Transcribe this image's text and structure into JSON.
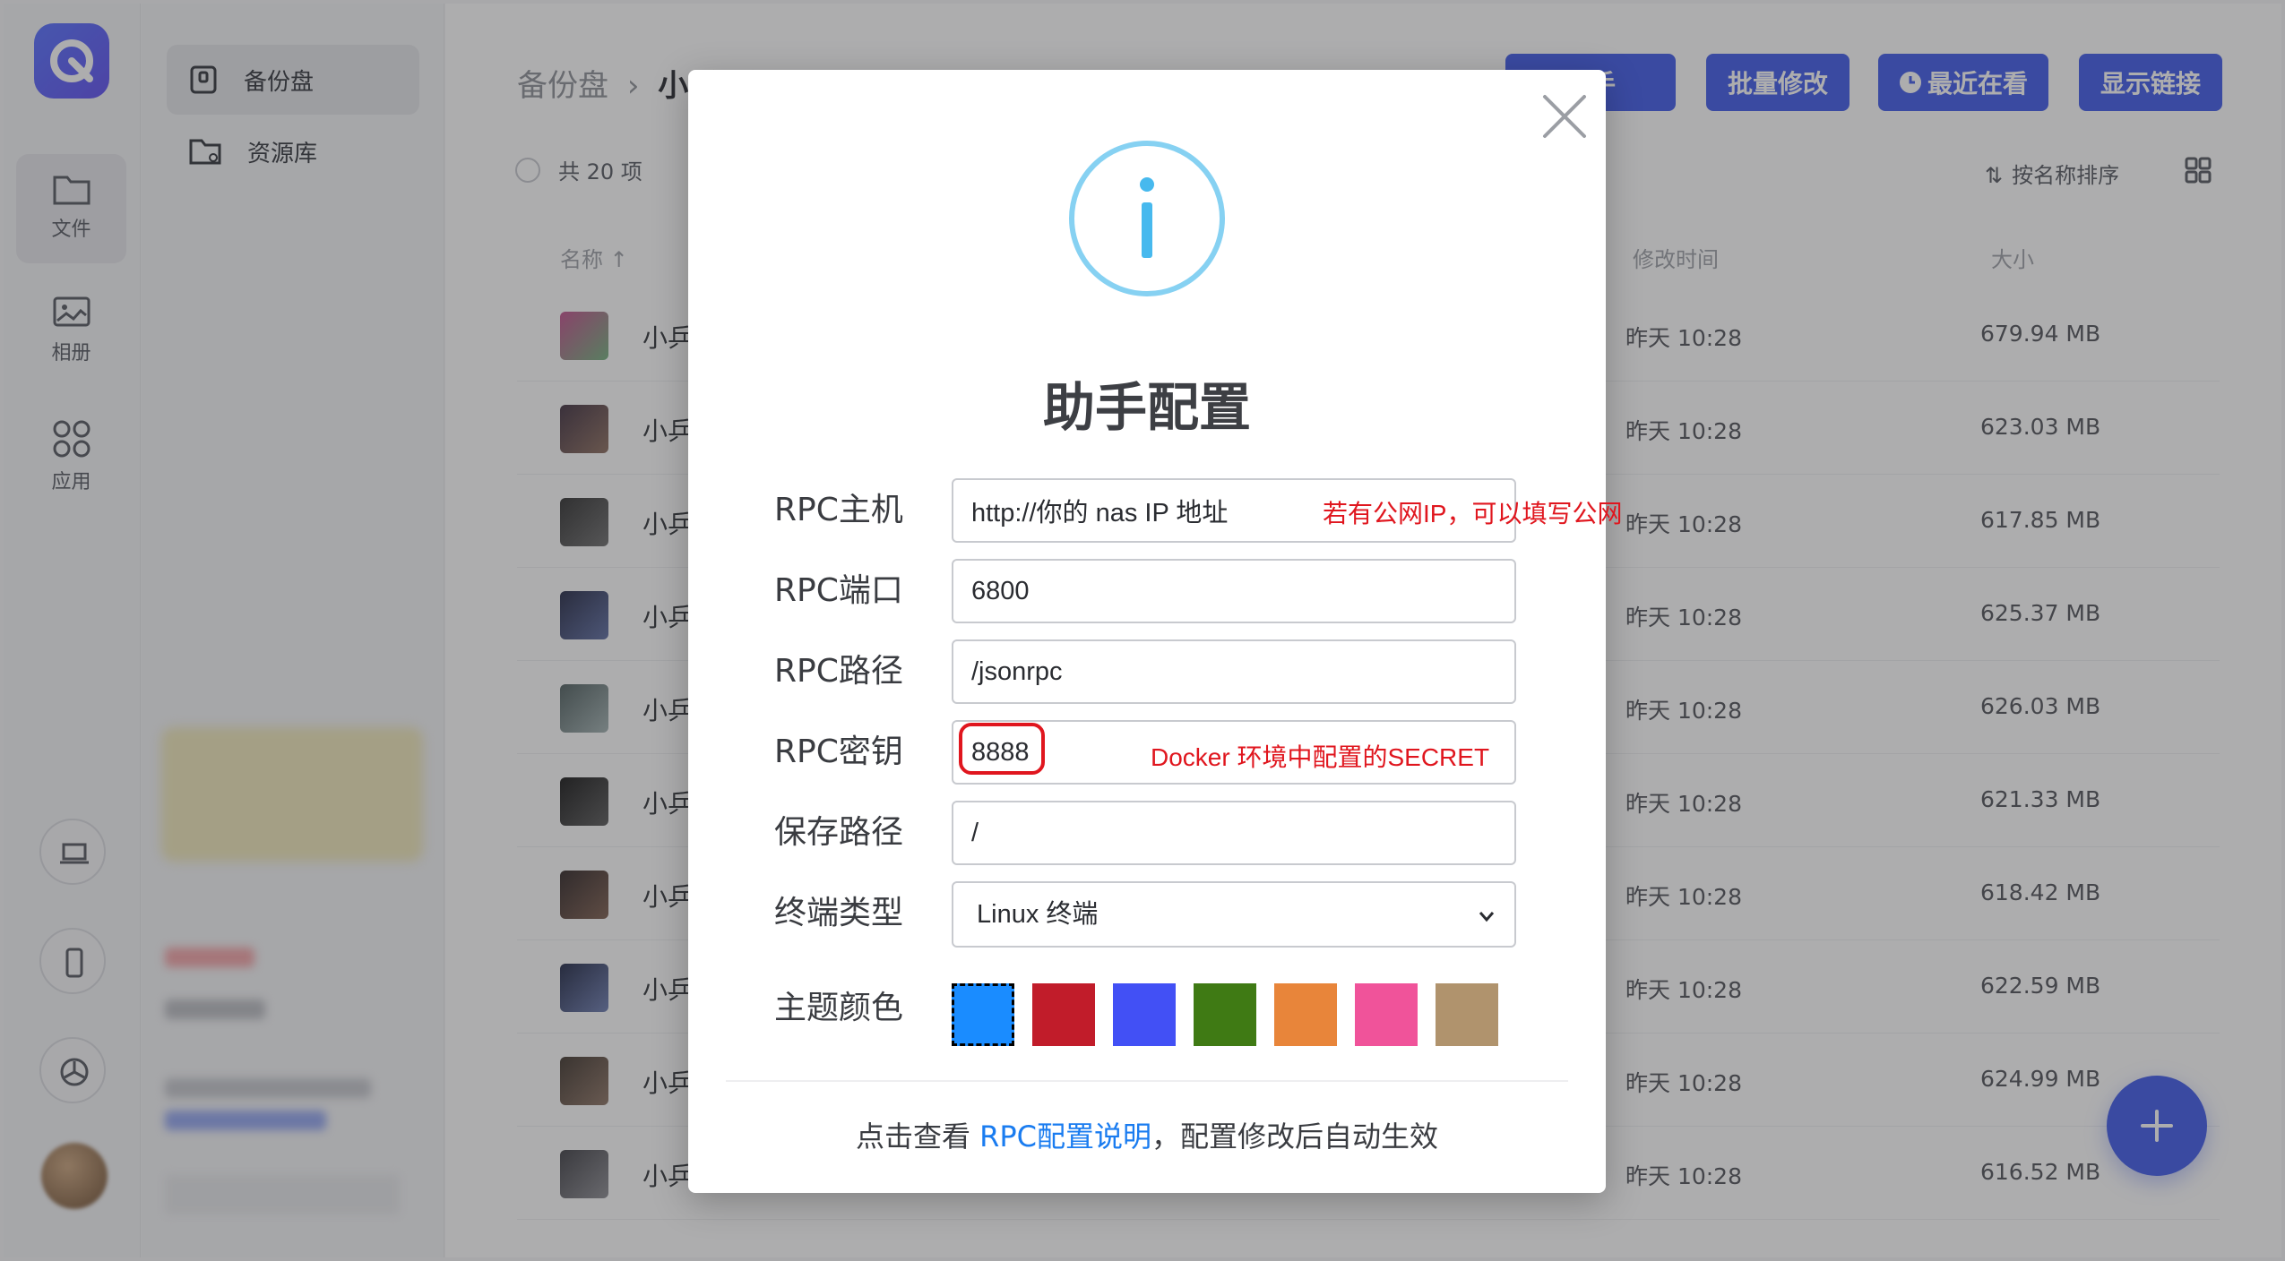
{
  "rail": {
    "items": [
      {
        "label": "文件"
      },
      {
        "label": "相册"
      },
      {
        "label": "应用"
      }
    ]
  },
  "sidebar": {
    "items": [
      {
        "label": "备份盘"
      },
      {
        "label": "资源库"
      }
    ]
  },
  "breadcrumb": {
    "root": "备份盘",
    "separator": "›",
    "current": "小乐张江"
  },
  "toolbar": {
    "helper_label": "助手",
    "batch_edit_label": "批量修改",
    "recent_label": "最近在看",
    "show_links_label": "显示链接"
  },
  "list": {
    "count_label": "共 20 项",
    "sort_label": "按名称排序",
    "columns": {
      "name": "名称",
      "modified": "修改时间",
      "size": "大小"
    },
    "rows": [
      {
        "name": "小乒",
        "modified": "昨天 10:28",
        "size": "679.94 MB"
      },
      {
        "name": "小乒",
        "modified": "昨天 10:28",
        "size": "623.03 MB"
      },
      {
        "name": "小乒",
        "modified": "昨天 10:28",
        "size": "617.85 MB"
      },
      {
        "name": "小乒",
        "modified": "昨天 10:28",
        "size": "625.37 MB"
      },
      {
        "name": "小乒",
        "modified": "昨天 10:28",
        "size": "626.03 MB"
      },
      {
        "name": "小乒",
        "modified": "昨天 10:28",
        "size": "621.33 MB"
      },
      {
        "name": "小乒",
        "modified": "昨天 10:28",
        "size": "618.42 MB"
      },
      {
        "name": "小乒",
        "modified": "昨天 10:28",
        "size": "622.59 MB"
      },
      {
        "name": "小乒",
        "modified": "昨天 10:28",
        "size": "624.99 MB"
      },
      {
        "name": "小乒",
        "modified": "昨天 10:28",
        "size": "616.52 MB"
      }
    ]
  },
  "modal": {
    "title": "助手配置",
    "fields": {
      "host": {
        "label": "RPC主机",
        "value": "http://你的 nas IP 地址",
        "hint": "若有公网IP，可以填写公网"
      },
      "port": {
        "label": "RPC端口",
        "value": "6800"
      },
      "path": {
        "label": "RPC路径",
        "value": "/jsonrpc"
      },
      "secret": {
        "label": "RPC密钥",
        "value": "8888",
        "hint": "Docker 环境中配置的SECRET"
      },
      "save_path": {
        "label": "保存路径",
        "value": "/"
      },
      "terminal": {
        "label": "终端类型",
        "selected": "Linux 终端"
      },
      "theme": {
        "label": "主题颜色",
        "colors": [
          "#1a8cff",
          "#c11c2a",
          "#4250f5",
          "#3f7a14",
          "#e8853a",
          "#f0539a",
          "#b0936d"
        ],
        "selected_index": 0
      }
    },
    "footer": {
      "prefix": "点击查看 ",
      "link": "RPC配置说明",
      "suffix": "，配置修改后自动生效"
    }
  }
}
